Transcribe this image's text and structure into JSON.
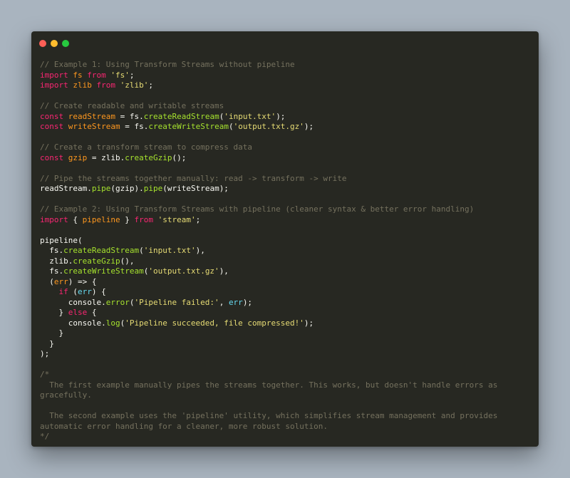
{
  "window": {
    "controls": {
      "close_color": "#ff5f56",
      "minimize_color": "#ffbd2e",
      "zoom_color": "#27c93f"
    }
  },
  "theme": {
    "background": "#272822",
    "plain": "#f8f8f2",
    "comment": "#75715e",
    "keyword": "#f92672",
    "string": "#e6db74",
    "function": "#a6e22e",
    "variable": "#fd971f"
  },
  "code": {
    "lines": [
      [
        {
          "t": "// Example 1: Using Transform Streams without pipeline",
          "c": "comment"
        }
      ],
      [
        {
          "t": "import",
          "c": "keyword"
        },
        {
          "t": " ",
          "c": "plain"
        },
        {
          "t": "fs",
          "c": "var"
        },
        {
          "t": " ",
          "c": "plain"
        },
        {
          "t": "from",
          "c": "keyword"
        },
        {
          "t": " ",
          "c": "plain"
        },
        {
          "t": "'fs'",
          "c": "string"
        },
        {
          "t": ";",
          "c": "plain"
        }
      ],
      [
        {
          "t": "import",
          "c": "keyword"
        },
        {
          "t": " ",
          "c": "plain"
        },
        {
          "t": "zlib",
          "c": "var"
        },
        {
          "t": " ",
          "c": "plain"
        },
        {
          "t": "from",
          "c": "keyword"
        },
        {
          "t": " ",
          "c": "plain"
        },
        {
          "t": "'zlib'",
          "c": "string"
        },
        {
          "t": ";",
          "c": "plain"
        }
      ],
      [],
      [
        {
          "t": "// Create readable and writable streams",
          "c": "comment"
        }
      ],
      [
        {
          "t": "const",
          "c": "keyword"
        },
        {
          "t": " ",
          "c": "plain"
        },
        {
          "t": "readStream",
          "c": "var"
        },
        {
          "t": " = fs.",
          "c": "plain"
        },
        {
          "t": "createReadStream",
          "c": "func"
        },
        {
          "t": "(",
          "c": "plain"
        },
        {
          "t": "'input.txt'",
          "c": "string"
        },
        {
          "t": ");",
          "c": "plain"
        }
      ],
      [
        {
          "t": "const",
          "c": "keyword"
        },
        {
          "t": " ",
          "c": "plain"
        },
        {
          "t": "writeStream",
          "c": "var"
        },
        {
          "t": " = fs.",
          "c": "plain"
        },
        {
          "t": "createWriteStream",
          "c": "func"
        },
        {
          "t": "(",
          "c": "plain"
        },
        {
          "t": "'output.txt.gz'",
          "c": "string"
        },
        {
          "t": ");",
          "c": "plain"
        }
      ],
      [],
      [
        {
          "t": "// Create a transform stream to compress data",
          "c": "comment"
        }
      ],
      [
        {
          "t": "const",
          "c": "keyword"
        },
        {
          "t": " ",
          "c": "plain"
        },
        {
          "t": "gzip",
          "c": "var"
        },
        {
          "t": " = zlib.",
          "c": "plain"
        },
        {
          "t": "createGzip",
          "c": "func"
        },
        {
          "t": "();",
          "c": "plain"
        }
      ],
      [],
      [
        {
          "t": "// Pipe the streams together manually: read -> transform -> write",
          "c": "comment"
        }
      ],
      [
        {
          "t": "readStream.",
          "c": "plain"
        },
        {
          "t": "pipe",
          "c": "func"
        },
        {
          "t": "(gzip).",
          "c": "plain"
        },
        {
          "t": "pipe",
          "c": "func"
        },
        {
          "t": "(writeStream);",
          "c": "plain"
        }
      ],
      [],
      [
        {
          "t": "// Example 2: Using Transform Streams with pipeline (cleaner syntax & better error handling)",
          "c": "comment"
        }
      ],
      [
        {
          "t": "import",
          "c": "keyword"
        },
        {
          "t": " { ",
          "c": "plain"
        },
        {
          "t": "pipeline",
          "c": "var"
        },
        {
          "t": " } ",
          "c": "plain"
        },
        {
          "t": "from",
          "c": "keyword"
        },
        {
          "t": " ",
          "c": "plain"
        },
        {
          "t": "'stream'",
          "c": "string"
        },
        {
          "t": ";",
          "c": "plain"
        }
      ],
      [],
      [
        {
          "t": "pipeline(",
          "c": "plain"
        }
      ],
      [
        {
          "t": "  fs.",
          "c": "plain"
        },
        {
          "t": "createReadStream",
          "c": "func"
        },
        {
          "t": "(",
          "c": "plain"
        },
        {
          "t": "'input.txt'",
          "c": "string"
        },
        {
          "t": "),",
          "c": "plain"
        }
      ],
      [
        {
          "t": "  zlib.",
          "c": "plain"
        },
        {
          "t": "createGzip",
          "c": "func"
        },
        {
          "t": "(),",
          "c": "plain"
        }
      ],
      [
        {
          "t": "  fs.",
          "c": "plain"
        },
        {
          "t": "createWriteStream",
          "c": "func"
        },
        {
          "t": "(",
          "c": "plain"
        },
        {
          "t": "'output.txt.gz'",
          "c": "string"
        },
        {
          "t": "),",
          "c": "plain"
        }
      ],
      [
        {
          "t": "  (",
          "c": "plain"
        },
        {
          "t": "err",
          "c": "param"
        },
        {
          "t": ") => {",
          "c": "plain"
        }
      ],
      [
        {
          "t": "    ",
          "c": "plain"
        },
        {
          "t": "if",
          "c": "keyword"
        },
        {
          "t": " (",
          "c": "plain"
        },
        {
          "t": "err",
          "c": "builtin"
        },
        {
          "t": ") {",
          "c": "plain"
        }
      ],
      [
        {
          "t": "      console.",
          "c": "plain"
        },
        {
          "t": "error",
          "c": "func"
        },
        {
          "t": "(",
          "c": "plain"
        },
        {
          "t": "'Pipeline failed:'",
          "c": "string"
        },
        {
          "t": ", ",
          "c": "plain"
        },
        {
          "t": "err",
          "c": "builtin"
        },
        {
          "t": ");",
          "c": "plain"
        }
      ],
      [
        {
          "t": "    } ",
          "c": "plain"
        },
        {
          "t": "else",
          "c": "keyword"
        },
        {
          "t": " {",
          "c": "plain"
        }
      ],
      [
        {
          "t": "      console.",
          "c": "plain"
        },
        {
          "t": "log",
          "c": "func"
        },
        {
          "t": "(",
          "c": "plain"
        },
        {
          "t": "'Pipeline succeeded, file compressed!'",
          "c": "string"
        },
        {
          "t": ");",
          "c": "plain"
        }
      ],
      [
        {
          "t": "    }",
          "c": "plain"
        }
      ],
      [
        {
          "t": "  }",
          "c": "plain"
        }
      ],
      [
        {
          "t": ");",
          "c": "plain"
        }
      ],
      [],
      [
        {
          "t": "/*",
          "c": "comment"
        }
      ],
      [
        {
          "t": "  The first example manually pipes the streams together. This works, but doesn't handle errors as",
          "c": "comment"
        }
      ],
      [
        {
          "t": "gracefully.",
          "c": "comment"
        }
      ],
      [],
      [
        {
          "t": "  The second example uses the 'pipeline' utility, which simplifies stream management and provides",
          "c": "comment"
        }
      ],
      [
        {
          "t": "automatic error handling for a cleaner, more robust solution.",
          "c": "comment"
        }
      ],
      [
        {
          "t": "*/",
          "c": "comment"
        }
      ]
    ]
  }
}
